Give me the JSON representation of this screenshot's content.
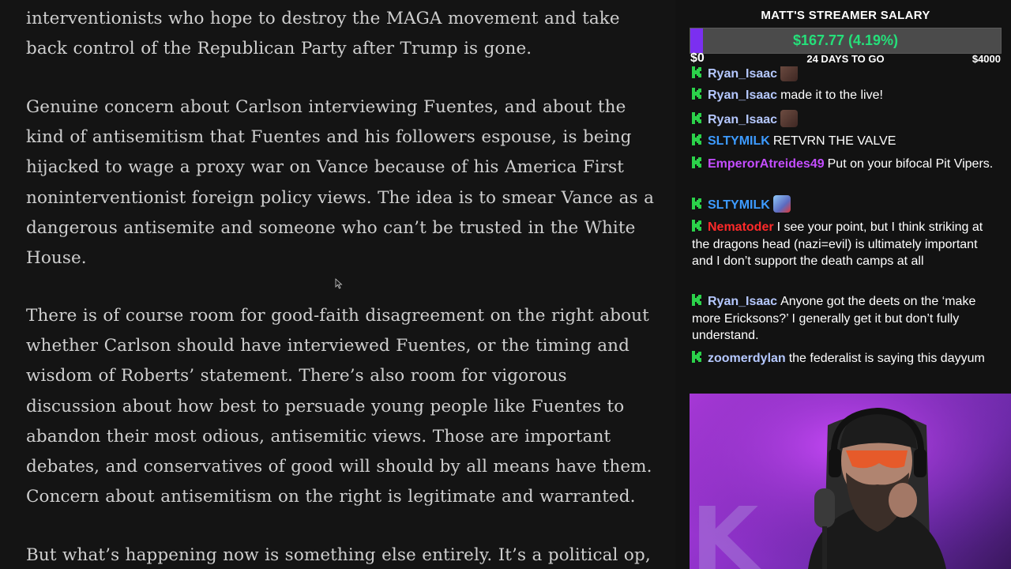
{
  "article": {
    "paragraphs": [
      "interventionists who hope to destroy the MAGA movement and take back control of the Republican Party after Trump is gone.",
      "Genuine concern about Carlson interviewing Fuentes, and about the kind of antisemitism that Fuentes and his followers espouse, is being hijacked to wage a proxy war on Vance because of his America First noninterventionist foreign policy views. The idea is to smear Vance as a dangerous antisemite and someone who can’t be trusted in the White House.",
      "There is of course room for good-faith disagreement on the right about whether Carlson should have interviewed Fuentes, or the timing and wisdom of Roberts’ statement. There’s also room for vigorous discussion about how best to persuade young people like Fuentes to abandon their most odious, antisemitic views. Those are important debates, and conservatives of good will should by all means have them. Concern about antisemitism on the right is legitimate and warranted.",
      "But what’s happening now is something else entirely. It’s a political op,"
    ]
  },
  "goal": {
    "title": "MATT'S STREAMER SALARY",
    "amount": "$167.77 (4.19%)",
    "progress_percent": 4.19,
    "min_label": "$0",
    "days_label": "24 DAYS TO GO",
    "max_label": "$4000"
  },
  "chat": {
    "messages": [
      {
        "user": "Ryan_Isaac",
        "color": "#b5c8ff",
        "text": "",
        "emote": "brown",
        "partial": true
      },
      {
        "user": "Ryan_Isaac",
        "color": "#b5c8ff",
        "text": "made it to the live!"
      },
      {
        "user": "Ryan_Isaac",
        "color": "#b5c8ff",
        "text": "",
        "emote": "brown"
      },
      {
        "user": "SLTYMILK",
        "color": "#3d9bff",
        "text": "RETVRN THE VALVE"
      },
      {
        "user": "EmperorAtreides49",
        "color": "#c44dff",
        "text": "Put on your bifocal Pit Vipers."
      },
      {
        "user": "SLTYMILK",
        "color": "#3d9bff",
        "text": "",
        "emote": "blue"
      },
      {
        "user": "Nematoder",
        "color": "#ff2a2a",
        "text": "I see your point, but I think striking at the dragons head (nazi=evil) is ultimately important and I don’t support the death camps at all"
      },
      {
        "user": "Ryan_Isaac",
        "color": "#b5c8ff",
        "text": "Anyone got the deets on the ‘make more Ericksons?’ I generally get it but don’t fully understand."
      },
      {
        "user": "zoomerdylan",
        "color": "#b5c8ff",
        "text": "the federalist is saying this dayyum"
      }
    ],
    "badge_color": "#2bd24a"
  },
  "webcam": {
    "backdrop_letter": "K",
    "accent_color": "#b13be0"
  }
}
